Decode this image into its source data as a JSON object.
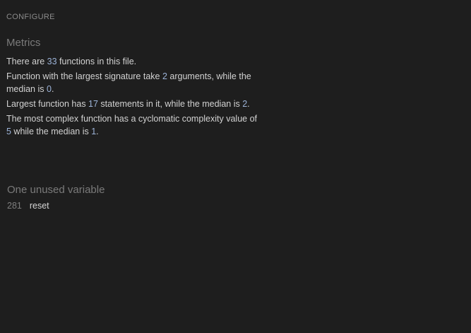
{
  "header": {
    "configure_label": "CONFIGURE"
  },
  "metrics": {
    "title": "Metrics",
    "functions": {
      "pre": "There are ",
      "count": "33",
      "post": " functions in this file."
    },
    "signature": {
      "pre": "Function with the largest signature take ",
      "max": "2",
      "mid": " arguments, while the median is ",
      "median": "0",
      "post": "."
    },
    "statements": {
      "pre": "Largest function has ",
      "max": "17",
      "mid": " statements in it, while the median is ",
      "median": "2",
      "post": "."
    },
    "complexity": {
      "pre": "The most complex function has a cyclomatic complexity value of ",
      "max": "5",
      "mid": " while the median is ",
      "median": "1",
      "post": "."
    }
  },
  "unused": {
    "title": "One unused variable",
    "items": [
      {
        "line": "281",
        "name": "reset"
      }
    ]
  }
}
